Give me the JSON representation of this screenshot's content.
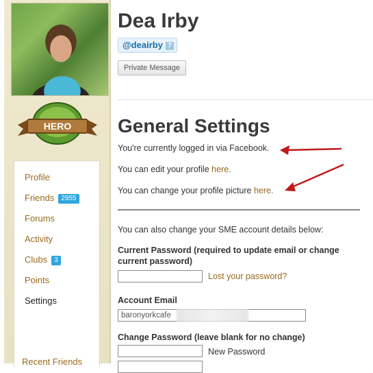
{
  "profile": {
    "name": "Dea Irby",
    "handle": "@deairby",
    "handle_help": "?",
    "private_message_label": "Private Message",
    "badge_text": "HERO"
  },
  "sidebar": {
    "items": [
      {
        "label": "Profile"
      },
      {
        "label": "Friends",
        "count": "2955"
      },
      {
        "label": "Forums"
      },
      {
        "label": "Activity"
      },
      {
        "label": "Clubs",
        "count": "3"
      },
      {
        "label": "Points"
      },
      {
        "label": "Settings",
        "active": true
      }
    ],
    "bottom_link": "Recent Friends"
  },
  "settings": {
    "title": "General Settings",
    "logged_in_text": "You're currently logged in via Facebook.",
    "edit_profile_text": "You can edit your profile ",
    "edit_profile_link": "here.",
    "change_picture_text": "You can change your profile picture ",
    "change_picture_link": "here.",
    "account_details_intro": "You can also change your SME account details below:",
    "current_password_label": "Current Password (required to update email or change current password)",
    "current_password_value": "",
    "lost_password_link": "Lost your password?",
    "account_email_label": "Account Email",
    "account_email_value": "baronyorkcafe",
    "change_password_label": "Change Password (leave blank for no change)",
    "new_password_value": "",
    "new_password_hint": "New Password"
  },
  "colors": {
    "link": "#9a6a1d",
    "arrow": "#c0181c",
    "badge_blue": "#2fa6df"
  }
}
